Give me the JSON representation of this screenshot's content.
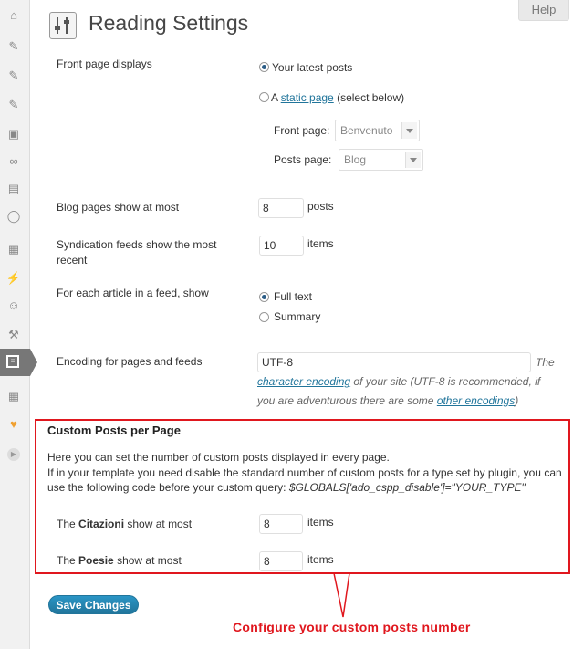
{
  "help_label": "Help",
  "page_title": "Reading Settings",
  "front_page": {
    "label": "Front page displays",
    "option_latest": "Your latest posts",
    "option_static_prefix": "A",
    "option_static_link": "static page",
    "option_static_suffix": "(select below)",
    "front_page_label": "Front page:",
    "front_page_value": "Benvenuto",
    "posts_page_label": "Posts page:",
    "posts_page_value": "Blog",
    "selected": "latest"
  },
  "blog_pages": {
    "label": "Blog pages show at most",
    "value": "8",
    "unit": "posts"
  },
  "syndication": {
    "label_line1": "Syndication feeds show the most",
    "label_line2": "recent",
    "value": "10",
    "unit": "items"
  },
  "feed_article": {
    "label": "For each article in a feed, show",
    "option_full": "Full text",
    "option_summary": "Summary",
    "selected": "full"
  },
  "encoding": {
    "label": "Encoding for pages and feeds",
    "value": "UTF-8",
    "desc_1": "The",
    "desc_link1": "character encoding",
    "desc_2": "of your site (UTF-8 is recommended, if",
    "desc_3": "you are adventurous there are some",
    "desc_link2": "other encodings",
    "desc_4": ")"
  },
  "custom_posts": {
    "title": "Custom Posts per Page",
    "line1": "Here you can set the number of custom posts displayed in every page.",
    "line2": "If in your template you need disable the standard number of custom posts for a type set by plugin, you can",
    "line3_prefix": "use the following code before your custom query:",
    "line3_code": "$GLOBALS['ado_cspp_disable']=\"YOUR_TYPE\"",
    "rows": [
      {
        "prefix": "The",
        "type": "Citazioni",
        "suffix": "show at most",
        "value": "8",
        "unit": "items"
      },
      {
        "prefix": "The",
        "type": "Poesie",
        "suffix": "show at most",
        "value": "8",
        "unit": "items"
      }
    ]
  },
  "save_label": "Save Changes",
  "callout": "Configure your custom posts number",
  "colors": {
    "highlight": "#e0171e",
    "link": "#21759b",
    "button": "#21759b"
  }
}
